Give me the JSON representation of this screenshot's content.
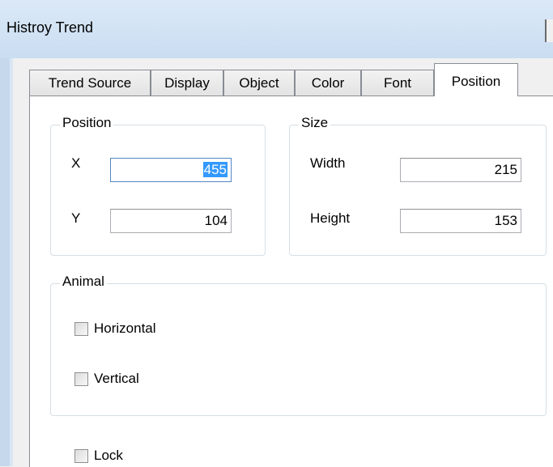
{
  "window": {
    "title": "Histroy Trend"
  },
  "tabs": [
    {
      "label": "Trend Source"
    },
    {
      "label": "Display"
    },
    {
      "label": "Object"
    },
    {
      "label": "Color"
    },
    {
      "label": "Font"
    },
    {
      "label": "Position",
      "active": true
    }
  ],
  "position_group": {
    "legend": "Position",
    "x_label": "X",
    "x_value": "455",
    "y_label": "Y",
    "y_value": "104"
  },
  "size_group": {
    "legend": "Size",
    "width_label": "Width",
    "width_value": "215",
    "height_label": "Height",
    "height_value": "153"
  },
  "animal_group": {
    "legend": "Animal",
    "horizontal_label": "Horizontal",
    "horizontal_checked": false,
    "vertical_label": "Vertical",
    "vertical_checked": false
  },
  "lock": {
    "label": "Lock",
    "checked": false
  }
}
